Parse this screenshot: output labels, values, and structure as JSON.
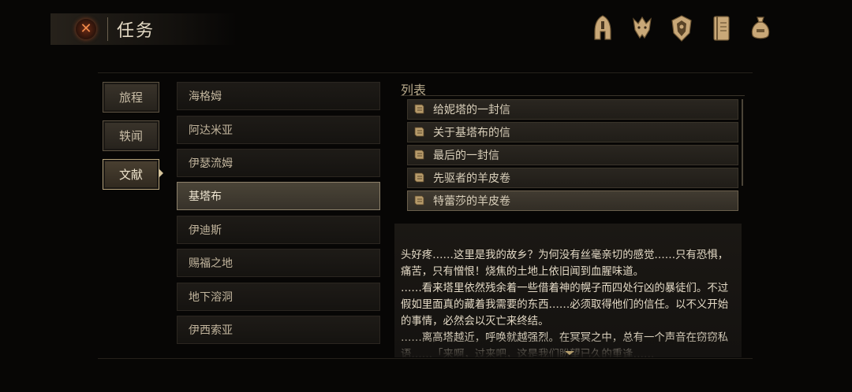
{
  "header": {
    "title": "任务",
    "close_icon": "close-icon"
  },
  "top_icons": [
    "helmet-icon",
    "wolf-emblem-icon",
    "shield-emblem-icon",
    "journal-icon",
    "pouch-icon"
  ],
  "categories": [
    {
      "label": "旅程",
      "active": false
    },
    {
      "label": "轶闻",
      "active": false
    },
    {
      "label": "文献",
      "active": true
    }
  ],
  "books": [
    {
      "label": "海格姆",
      "selected": false
    },
    {
      "label": "阿达米亚",
      "selected": false
    },
    {
      "label": "伊瑟流姆",
      "selected": false
    },
    {
      "label": "基塔布",
      "selected": true
    },
    {
      "label": "伊迪斯",
      "selected": false
    },
    {
      "label": "赐福之地",
      "selected": false
    },
    {
      "label": "地下溶洞",
      "selected": false
    },
    {
      "label": "伊西索亚",
      "selected": false
    }
  ],
  "list": {
    "label": "列表",
    "items": [
      {
        "label": "给妮塔的一封信",
        "selected": false
      },
      {
        "label": "关于基塔布的信",
        "selected": false
      },
      {
        "label": "最后的一封信",
        "selected": false
      },
      {
        "label": "先驱者的羊皮卷",
        "selected": false
      },
      {
        "label": "特蕾莎的羊皮卷",
        "selected": true
      }
    ]
  },
  "document_text": "头好疼……这里是我的故乡？为何没有丝毫亲切的感觉……只有恐惧，痛苦，只有憎恨！烧焦的土地上依旧闻到血腥味道。\n……看来塔里依然残余着一些借着神的幌子而四处行凶的暴徒们。不过假如里面真的藏着我需要的东西……必须取得他们的信任。以不义开始的事情，必然会以灭亡来终结。\n……离高塔越近，呼唤就越强烈。在冥冥之中，总有一个声音在窃窃私语……「来啊，过来吧，这是我们盼望已久的重逢……"
}
